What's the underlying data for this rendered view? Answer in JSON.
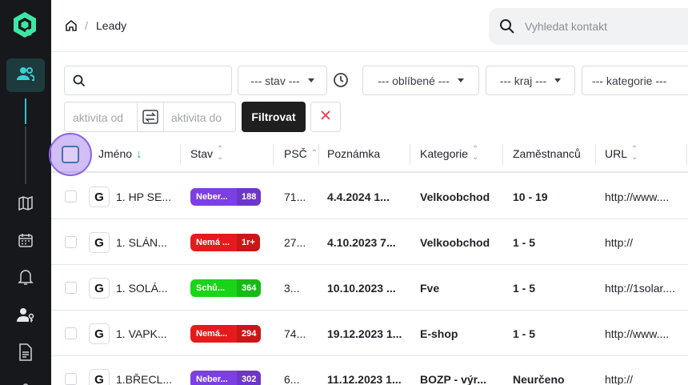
{
  "breadcrumb": {
    "title": "Leady"
  },
  "search": {
    "placeholder": "Vyhledat kontakt"
  },
  "filters": {
    "stav": "--- stav ---",
    "oblibene": "--- oblíbené ---",
    "kraj": "--- kraj ---",
    "kategorie": "--- kategorie ---",
    "aktivita_od": "aktivita od",
    "aktivita_do": "aktivita do",
    "filter_button": "Filtrovat"
  },
  "columns": [
    "Jméno",
    "Stav",
    "PSČ",
    "Poznámka",
    "Kategorie",
    "Zaměstnanců",
    "URL"
  ],
  "rows": [
    {
      "name": "1. HP SE...",
      "status": "Neber...",
      "status_count": "188",
      "status_color": "#7b3fe4",
      "psc": "71...",
      "note": "4.4.2024 1...",
      "category": "Velkoobchod",
      "employees": "10 - 19",
      "url": "http://www...."
    },
    {
      "name": "1. SLÁN...",
      "status": "Nemá ...",
      "status_count": "1r+",
      "status_color": "#e51b1b",
      "psc": "27...",
      "note": "4.10.2023 7...",
      "category": "Velkoobchod",
      "employees": "1 - 5",
      "url": "http://"
    },
    {
      "name": "1. SOLÁ...",
      "status": "Schů...",
      "status_count": "364",
      "status_color": "#19d419",
      "psc": "3...",
      "note": "10.10.2023 ...",
      "category": "Fve",
      "employees": "1 - 5",
      "url": "http://1solar...."
    },
    {
      "name": "1. VAPK...",
      "status": "Nemá...",
      "status_count": "294",
      "status_color": "#e51b1b",
      "psc": "74...",
      "note": "19.12.2023 1...",
      "category": "E-shop",
      "employees": "1 - 5",
      "url": "http://www...."
    },
    {
      "name": "1.BŘECL...",
      "status": "Neber...",
      "status_count": "302",
      "status_color": "#7b3fe4",
      "psc": "6...",
      "note": "11.12.2023 1...",
      "category": "BOZP - výr...",
      "employees": "Neurčeno",
      "url": "http://"
    }
  ],
  "colors": {
    "accent": "#22c3c9",
    "sidebar": "#16181b",
    "focus": "#8c64e6"
  }
}
